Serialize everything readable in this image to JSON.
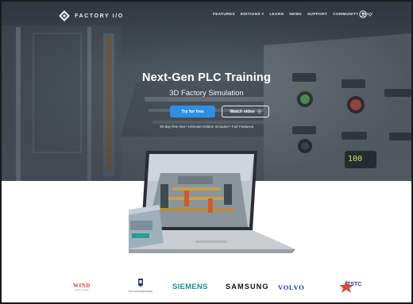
{
  "brand": {
    "name": "FACTORY I/O",
    "logo_icon": "diamond-logo-icon"
  },
  "nav": {
    "items": [
      "FEATURES",
      "EDITIONS ▾",
      "LEARN",
      "NEWS",
      "SUPPORT",
      "COMMUNITY",
      "BUY"
    ],
    "account_icon": "account-icon",
    "account_chevron": "▾"
  },
  "hero": {
    "title": "Next-Gen PLC Training",
    "subtitle": "3D Factory Simulation",
    "primary_button": "Try for free",
    "secondary_button": "Watch video",
    "secondary_button_icon": "play-circle-icon",
    "note": "30-day free trial • Ultimate Edition Included • Full Featured",
    "panel_display": "100"
  },
  "partners": {
    "wind": "WIND",
    "wind_sub": "RIVER SYSTEMS",
    "tbs_name": "Technische Bedrijfs Spindes",
    "siemens": "SIEMENS",
    "samsung": "SAMSUNG",
    "volvo": "VOLVO",
    "tstc": "TSTC"
  },
  "colors": {
    "accent": "#2f8fe3",
    "siemens": "#13969b",
    "wind": "#d33a2c",
    "volvo": "#1b3a8c"
  }
}
